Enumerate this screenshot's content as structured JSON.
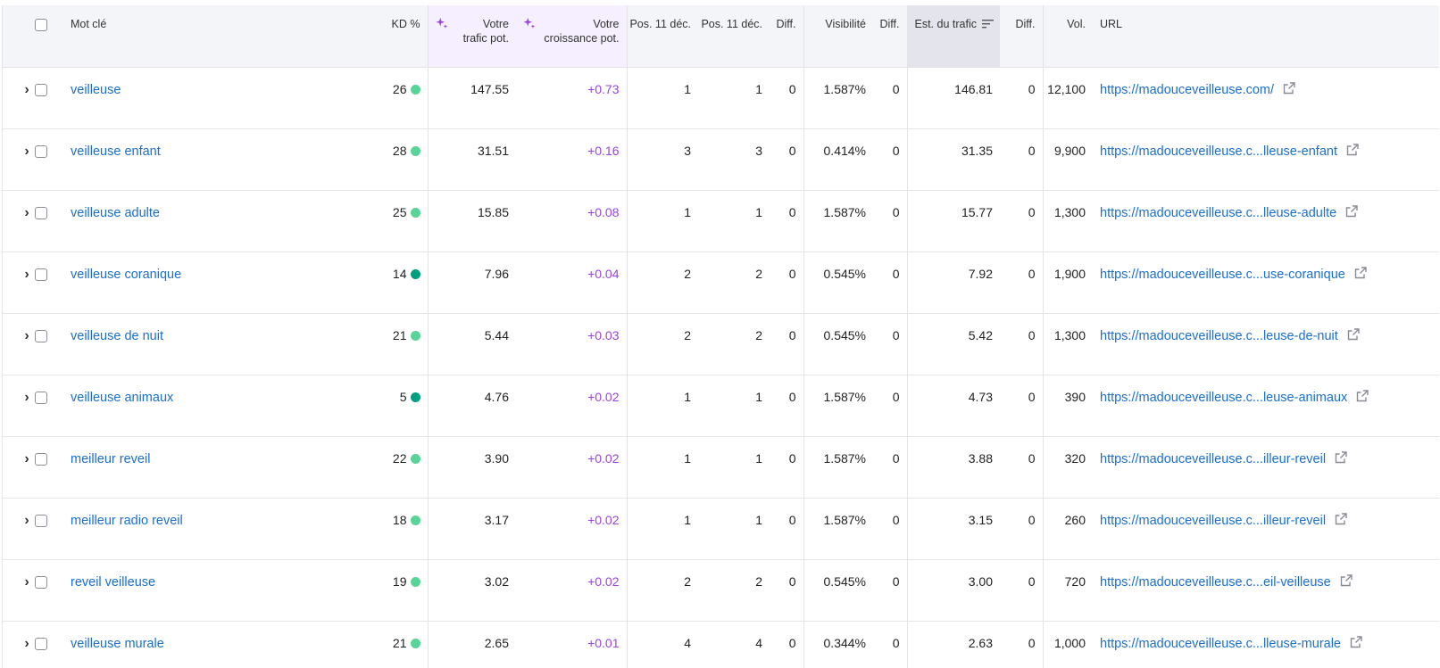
{
  "colors": {
    "link": "#1a6fcf",
    "positive_delta": "#9b42e0",
    "kd_light": "#59d499",
    "kd_dark": "#009f81",
    "header_bg": "#f4f5f9",
    "ai_header_bg": "#f6efff",
    "sorted_header_bg": "#e4e5ec"
  },
  "icons": {
    "expand": "chevron-right-icon",
    "external": "external-link-icon",
    "ai": "sparkle-icon",
    "sort": "sort-descending-icon"
  },
  "headers": {
    "keyword": "Mot clé",
    "kd": "KD %",
    "pot_traffic_1": "Votre",
    "pot_traffic_2": "trafic pot.",
    "pot_growth_1": "Votre",
    "pot_growth_2": "croissance pot.",
    "pos_a": "Pos. 11 déc.",
    "pos_b": "Pos. 11 déc.",
    "diff1": "Diff.",
    "visibility": "Visibilité",
    "diff2": "Diff.",
    "traffic": "Est. du trafic",
    "diff3": "Diff.",
    "volume": "Vol.",
    "url": "URL"
  },
  "rows": [
    {
      "keyword": "veilleuse",
      "kd": "26",
      "kd_level": "light",
      "pot_traffic": "147.55",
      "pot_growth": "+0.73",
      "pos_a": "1",
      "pos_b": "1",
      "diff1": "0",
      "visibility": "1.587%",
      "diff2": "0",
      "traffic": "146.81",
      "diff3": "0",
      "volume": "12,100",
      "url": "https://madouceveilleuse.com/"
    },
    {
      "keyword": "veilleuse enfant",
      "kd": "28",
      "kd_level": "light",
      "pot_traffic": "31.51",
      "pot_growth": "+0.16",
      "pos_a": "3",
      "pos_b": "3",
      "diff1": "0",
      "visibility": "0.414%",
      "diff2": "0",
      "traffic": "31.35",
      "diff3": "0",
      "volume": "9,900",
      "url": "https://madouceveilleuse.c...lleuse-enfant"
    },
    {
      "keyword": "veilleuse adulte",
      "kd": "25",
      "kd_level": "light",
      "pot_traffic": "15.85",
      "pot_growth": "+0.08",
      "pos_a": "1",
      "pos_b": "1",
      "diff1": "0",
      "visibility": "1.587%",
      "diff2": "0",
      "traffic": "15.77",
      "diff3": "0",
      "volume": "1,300",
      "url": "https://madouceveilleuse.c...lleuse-adulte"
    },
    {
      "keyword": "veilleuse coranique",
      "kd": "14",
      "kd_level": "dark",
      "pot_traffic": "7.96",
      "pot_growth": "+0.04",
      "pos_a": "2",
      "pos_b": "2",
      "diff1": "0",
      "visibility": "0.545%",
      "diff2": "0",
      "traffic": "7.92",
      "diff3": "0",
      "volume": "1,900",
      "url": "https://madouceveilleuse.c...use-coranique"
    },
    {
      "keyword": "veilleuse de nuit",
      "kd": "21",
      "kd_level": "light",
      "pot_traffic": "5.44",
      "pot_growth": "+0.03",
      "pos_a": "2",
      "pos_b": "2",
      "diff1": "0",
      "visibility": "0.545%",
      "diff2": "0",
      "traffic": "5.42",
      "diff3": "0",
      "volume": "1,300",
      "url": "https://madouceveilleuse.c...leuse-de-nuit"
    },
    {
      "keyword": "veilleuse animaux",
      "kd": "5",
      "kd_level": "dark",
      "pot_traffic": "4.76",
      "pot_growth": "+0.02",
      "pos_a": "1",
      "pos_b": "1",
      "diff1": "0",
      "visibility": "1.587%",
      "diff2": "0",
      "traffic": "4.73",
      "diff3": "0",
      "volume": "390",
      "url": "https://madouceveilleuse.c...leuse-animaux"
    },
    {
      "keyword": "meilleur reveil",
      "kd": "22",
      "kd_level": "light",
      "pot_traffic": "3.90",
      "pot_growth": "+0.02",
      "pos_a": "1",
      "pos_b": "1",
      "diff1": "0",
      "visibility": "1.587%",
      "diff2": "0",
      "traffic": "3.88",
      "diff3": "0",
      "volume": "320",
      "url": "https://madouceveilleuse.c...illeur-reveil"
    },
    {
      "keyword": "meilleur radio reveil",
      "kd": "18",
      "kd_level": "light",
      "pot_traffic": "3.17",
      "pot_growth": "+0.02",
      "pos_a": "1",
      "pos_b": "1",
      "diff1": "0",
      "visibility": "1.587%",
      "diff2": "0",
      "traffic": "3.15",
      "diff3": "0",
      "volume": "260",
      "url": "https://madouceveilleuse.c...illeur-reveil"
    },
    {
      "keyword": "reveil veilleuse",
      "kd": "19",
      "kd_level": "light",
      "pot_traffic": "3.02",
      "pot_growth": "+0.02",
      "pos_a": "2",
      "pos_b": "2",
      "diff1": "0",
      "visibility": "0.545%",
      "diff2": "0",
      "traffic": "3.00",
      "diff3": "0",
      "volume": "720",
      "url": "https://madouceveilleuse.c...eil-veilleuse"
    },
    {
      "keyword": "veilleuse murale",
      "kd": "21",
      "kd_level": "light",
      "pot_traffic": "2.65",
      "pot_growth": "+0.01",
      "pos_a": "4",
      "pos_b": "4",
      "diff1": "0",
      "visibility": "0.344%",
      "diff2": "0",
      "traffic": "2.63",
      "diff3": "0",
      "volume": "1,000",
      "url": "https://madouceveilleuse.c...lleuse-murale"
    }
  ]
}
